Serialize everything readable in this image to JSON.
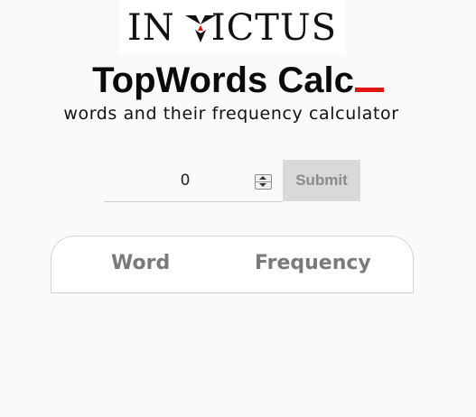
{
  "logo": {
    "text_left": "IN",
    "text_right": "ICTUS",
    "icon": "invictus-v-logo-icon",
    "accent": "#e0140e"
  },
  "header": {
    "title": "TopWords Calc",
    "subtitle": "words and their frequency calculator",
    "cursor_color": "#e0140e"
  },
  "form": {
    "number_value": "0",
    "spinner_icon": "stepper-arrows-icon",
    "submit_label": "Submit"
  },
  "table": {
    "columns": [
      "Word",
      "Frequency"
    ]
  },
  "colors": {
    "background": "#fafafa",
    "button_bg": "#d9d9d9",
    "button_text": "#8a8a8a",
    "header_text": "#7a7a7a"
  }
}
